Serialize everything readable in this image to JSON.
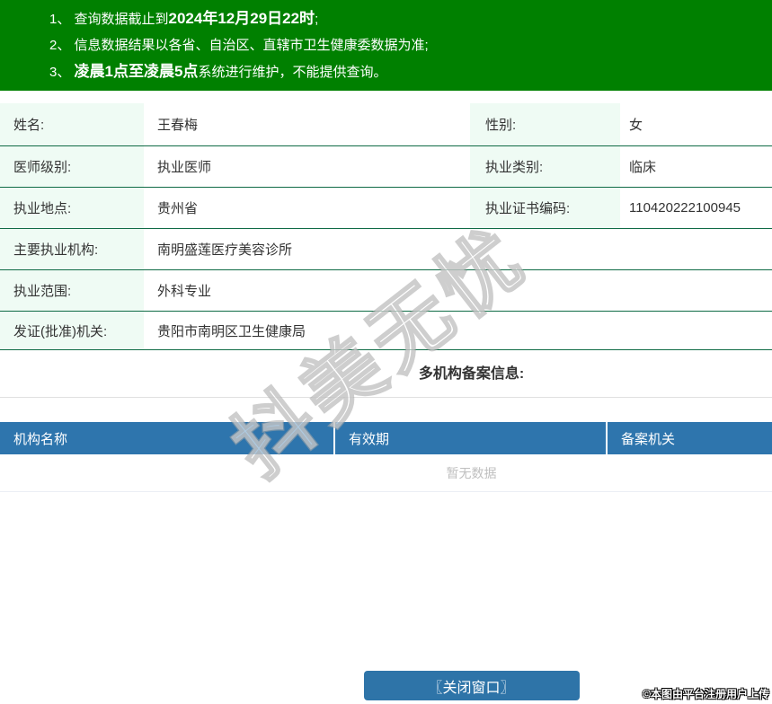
{
  "colors": {
    "banner_green": "#008000",
    "label_cell_bg": "#effbf4",
    "row_border_green": "#0f6b45",
    "table_header_blue": "#2e75ad",
    "button_blue": "#2e74a8",
    "empty_text_gray": "#bfbfbf"
  },
  "banner": {
    "notice1_pre": "1、 查询数据截止到",
    "notice1_bold": "2024年12月29日22时",
    "notice1_post": ";",
    "notice2": "2、 信息数据结果以各省、自治区、直辖市卫生健康委数据为准;",
    "notice3_pre": "3、 ",
    "notice3_bold": "凌晨1点至凌晨5点",
    "notice3_post": "系统进行维护，不能提供查询。"
  },
  "info": {
    "name_label": "姓名:",
    "name_value": "王春梅",
    "gender_label": "性别:",
    "gender_value": "女",
    "level_label": "医师级别:",
    "level_value": "执业医师",
    "category_label": "执业类别:",
    "category_value": "临床",
    "location_label": "执业地点:",
    "location_value": "贵州省",
    "cert_label": "执业证书编码:",
    "cert_value": "110420222100945",
    "org_label": "主要执业机构:",
    "org_value": "南明盛莲医疗美容诊所",
    "scope_label": "执业范围:",
    "scope_value": "外科专业",
    "issuer_label": "发证(批准)机关:",
    "issuer_value": "贵阳市南明区卫生健康局"
  },
  "multi_org": {
    "title": "多机构备案信息:",
    "columns": {
      "org_name": "机构名称",
      "validity": "有效期",
      "authority": "备案机关"
    },
    "empty_text": "暂无数据"
  },
  "footer": {
    "close_button_label": "〖关闭窗口〗",
    "copyright": "©本图由平台注册用户上传"
  },
  "watermark": {
    "text": "抖美无忧"
  }
}
